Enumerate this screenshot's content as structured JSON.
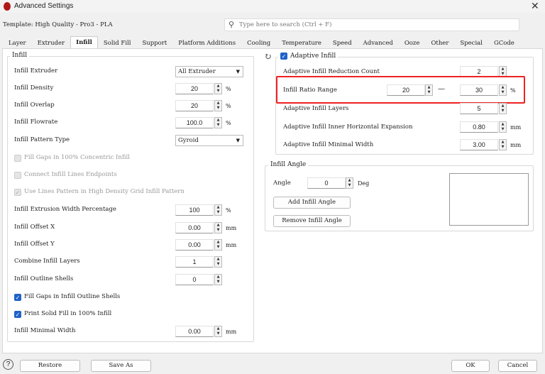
{
  "window": {
    "title": "Advanced Settings",
    "close": "✕"
  },
  "template": "Template: High Quality - Pro3 - PLA",
  "search": {
    "placeholder": "Type here to search (Ctrl + F)",
    "icon": "search-icon"
  },
  "tabs": [
    "Layer",
    "Extruder",
    "Infill",
    "Solid Fill",
    "Support",
    "Platform Additions",
    "Cooling",
    "Temperature",
    "Speed",
    "Advanced",
    "Ooze",
    "Other",
    "Special",
    "GCode"
  ],
  "active_tab": "Infill",
  "infill": {
    "title": "Infill",
    "rows": [
      {
        "type": "combo",
        "label": "Infill Extruder",
        "value": "All Extruder"
      },
      {
        "type": "spin",
        "label": "Infill Density",
        "value": "20",
        "unit": "%"
      },
      {
        "type": "spin",
        "label": "Infill Overlap",
        "value": "20",
        "unit": "%"
      },
      {
        "type": "spin",
        "label": "Infill Flowrate",
        "value": "100.0",
        "unit": "%"
      },
      {
        "type": "combo",
        "label": "Infill Pattern Type",
        "value": "Gyroid"
      },
      {
        "type": "check",
        "label": "Fill Gaps in 100% Concentric Infill",
        "state": "disabled-off"
      },
      {
        "type": "check",
        "label": "Connect Infill Lines Endpoints",
        "state": "disabled-off"
      },
      {
        "type": "check",
        "label": "Use Lines Pattern in High Density Grid Infill Pattern",
        "state": "disabled-on"
      },
      {
        "type": "spin",
        "label": "Infill Extrusion Width Percentage",
        "value": "100",
        "unit": "%"
      },
      {
        "type": "spin",
        "label": "Infill Offset X",
        "value": "0.00",
        "unit": "mm"
      },
      {
        "type": "spin",
        "label": "Infill Offset Y",
        "value": "0.00",
        "unit": "mm"
      },
      {
        "type": "spin",
        "label": "Combine Infill Layers",
        "value": "1",
        "unit": ""
      },
      {
        "type": "spin",
        "label": "Infill Outline Shells",
        "value": "0",
        "unit": ""
      },
      {
        "type": "check",
        "label": "Fill Gaps in Infill Outline Shells",
        "state": "on"
      },
      {
        "type": "check",
        "label": "Print Solid Fill in 100% Infill",
        "state": "on"
      },
      {
        "type": "spin",
        "label": "Infill Minimal Width",
        "value": "0.00",
        "unit": "mm"
      }
    ]
  },
  "adaptive": {
    "title": "Adaptive Infill",
    "checked": true,
    "reduction": {
      "label": "Adaptive Infill Reduction Count",
      "value": "2"
    },
    "ratio": {
      "label": "Infill Ratio Range",
      "min": "20",
      "sep": "—",
      "max": "30",
      "unit": "%"
    },
    "layers": {
      "label": "Adaptive Infill Layers",
      "value": "5"
    },
    "expansion": {
      "label": "Adaptive Infill Inner Horizontal Expansion",
      "value": "0.80",
      "unit": "mm"
    },
    "minwidth": {
      "label": "Adaptive Infill Minimal Width",
      "value": "3.00",
      "unit": "mm"
    }
  },
  "angle": {
    "title": "Infill Angle",
    "label": "Angle",
    "value": "0",
    "unit": "Deg",
    "add": "Add Infill Angle",
    "remove": "Remove Infill Angle"
  },
  "footer": {
    "help": "?",
    "restore": "Restore",
    "save_as": "Save As",
    "ok": "OK",
    "cancel": "Cancel"
  },
  "colors": {
    "highlight": "#e22222",
    "checkbox": "#1f62c8"
  }
}
